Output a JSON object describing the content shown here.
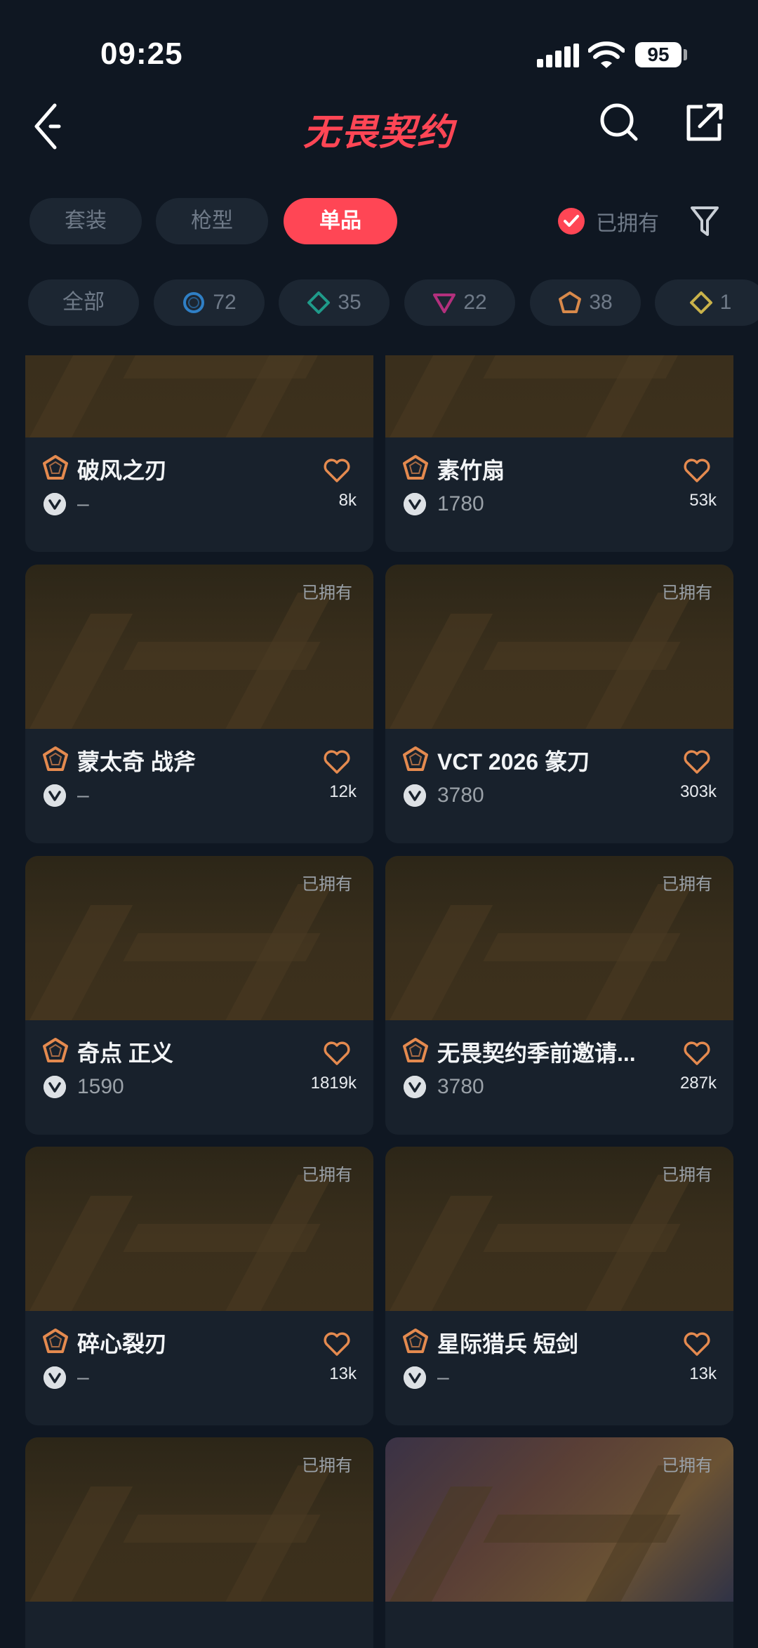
{
  "status_bar": {
    "time": "09:25",
    "battery": "95"
  },
  "header": {
    "title": "无畏契约"
  },
  "tabs": [
    {
      "label": "套装",
      "active": false
    },
    {
      "label": "枪型",
      "active": false
    },
    {
      "label": "单品",
      "active": true
    }
  ],
  "owned_filter": {
    "label": "已拥有",
    "checked": true
  },
  "tier_chips": [
    {
      "label": "全部"
    },
    {
      "label": "72",
      "icon": "select-tier-icon",
      "color": "#2f7fc5"
    },
    {
      "label": "35",
      "icon": "deluxe-tier-icon",
      "color": "#1f9a8a"
    },
    {
      "label": "22",
      "icon": "premium-tier-icon",
      "color": "#b3307d"
    },
    {
      "label": "38",
      "icon": "exclusive-tier-icon",
      "color": "#d8894a"
    },
    {
      "label": "1",
      "icon": "ultra-tier-icon",
      "color": "#c9b24a"
    }
  ],
  "owned_text": "已拥有",
  "colors": {
    "accent": "#ff4655",
    "background": "#0f1722",
    "card": "#18212c",
    "exclusive": "#e48a4f"
  },
  "items": [
    {
      "name": "破风之刃",
      "price": "–",
      "likes": "8k",
      "owned": false
    },
    {
      "name": "素竹扇",
      "price": "1780",
      "likes": "53k",
      "owned": false
    },
    {
      "name": "蒙太奇 战斧",
      "price": "–",
      "likes": "12k",
      "owned": true
    },
    {
      "name": "VCT 2026 篆刀",
      "price": "3780",
      "likes": "303k",
      "owned": true
    },
    {
      "name": "奇点 正义",
      "price": "1590",
      "likes": "1819k",
      "owned": true
    },
    {
      "name": "无畏契约季前邀请...",
      "price": "3780",
      "likes": "287k",
      "owned": true
    },
    {
      "name": "碎心裂刃",
      "price": "–",
      "likes": "13k",
      "owned": true
    },
    {
      "name": "星际猎兵 短剑",
      "price": "–",
      "likes": "13k",
      "owned": true
    },
    {
      "name": "",
      "price": "",
      "likes": "",
      "owned": true
    },
    {
      "name": "",
      "price": "",
      "likes": "",
      "owned": true
    }
  ]
}
